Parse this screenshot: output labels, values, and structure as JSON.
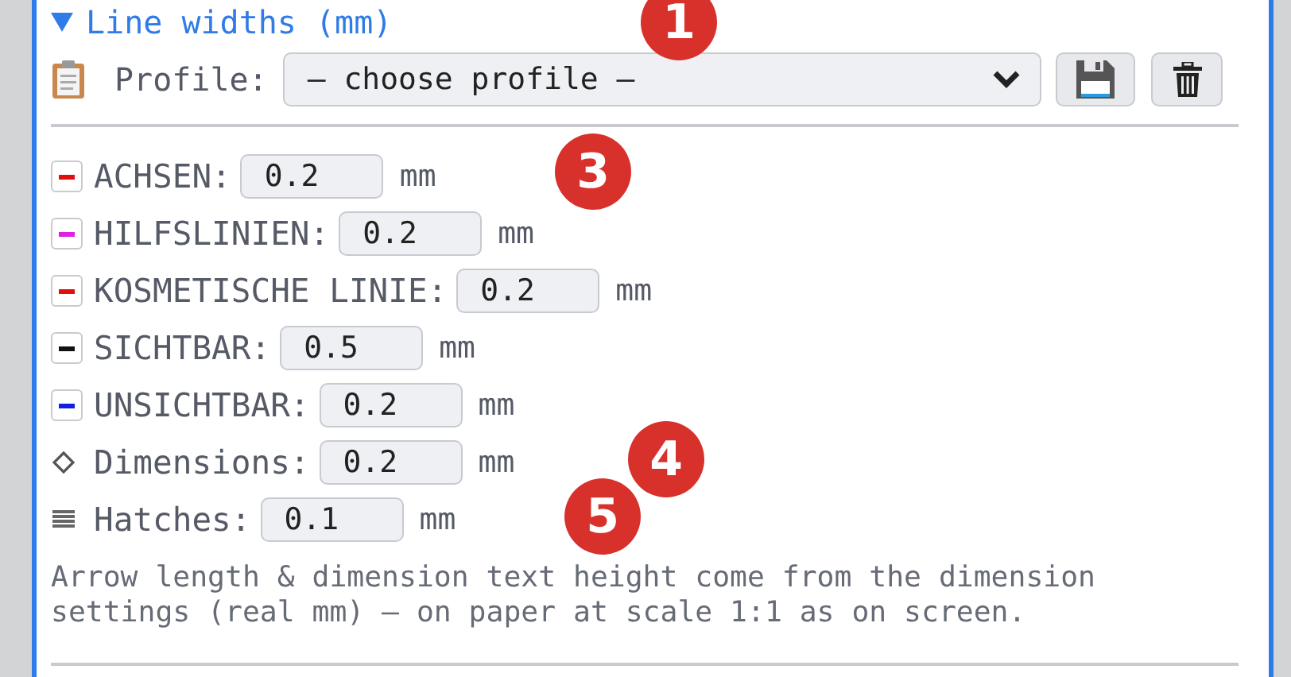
{
  "section": {
    "title": "Line widths (mm)",
    "expanded": true
  },
  "profile": {
    "label": "Profile:",
    "placeholder": "— choose profile —"
  },
  "rows": [
    {
      "kind": "line",
      "label": "ACHSEN:",
      "value": "0.2",
      "unit": "mm",
      "color": "#e01010"
    },
    {
      "kind": "line",
      "label": "HILFSLINIEN:",
      "value": "0.2",
      "unit": "mm",
      "color": "#e020e0"
    },
    {
      "kind": "line",
      "label": "KOSMETISCHE LINIE:",
      "value": "0.2",
      "unit": "mm",
      "color": "#e01010"
    },
    {
      "kind": "line",
      "label": "SICHTBAR:",
      "value": "0.5",
      "unit": "mm",
      "color": "#111111"
    },
    {
      "kind": "line",
      "label": "UNSICHTBAR:",
      "value": "0.2",
      "unit": "mm",
      "color": "#1020e0"
    },
    {
      "kind": "dimensions",
      "label": "Dimensions:",
      "value": "0.2",
      "unit": "mm"
    },
    {
      "kind": "hatches",
      "label": "Hatches:",
      "value": "0.1",
      "unit": "mm"
    }
  ],
  "note": "Arrow length & dimension text height come from the dimension settings (real mm) — on paper at scale 1:1 as on screen.",
  "markers": [
    "1",
    "3",
    "4",
    "5"
  ]
}
